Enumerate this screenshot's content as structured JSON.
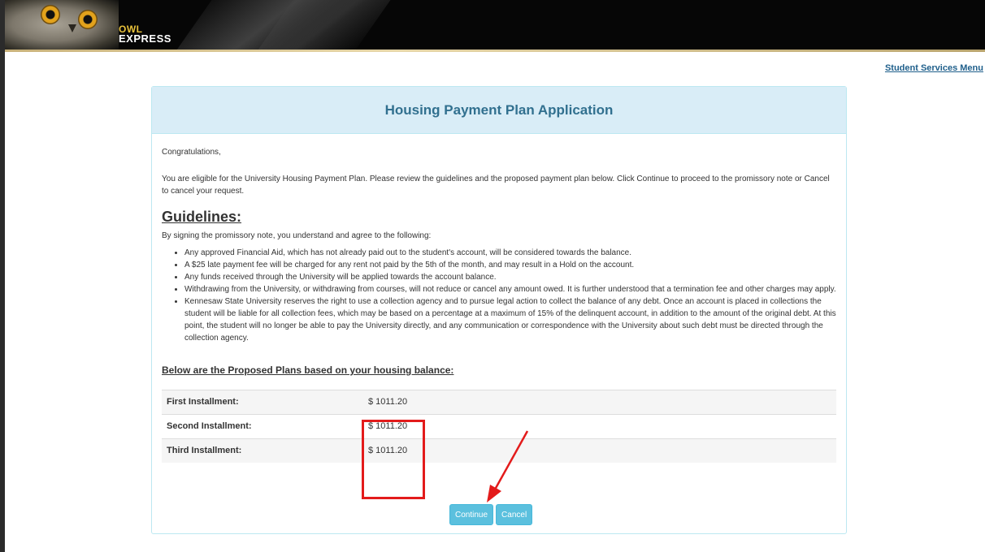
{
  "header": {
    "logo_line1": "OWL",
    "logo_line2": "EXPRESS"
  },
  "nav": {
    "student_services_menu": "Student Services Menu"
  },
  "panel": {
    "title": "Housing Payment Plan Application",
    "greeting": "Congratulations,",
    "eligibility_text": "You are eligible for the University Housing Payment Plan. Please review the guidelines and the proposed payment plan below. Click Continue to proceed to the promissory note or Cancel to cancel your request.",
    "guidelines_heading": "Guidelines:",
    "guidelines_intro": "By signing the promissory note, you understand and agree to the following:",
    "guidelines": [
      "Any approved Financial Aid, which has not already paid out to the student's account, will be considered towards the balance.",
      "A $25 late payment fee will be charged for any rent not paid by the 5th of the month, and may result in a Hold on the account.",
      "Any funds received through the University will be applied towards the account balance.",
      "Withdrawing from the University, or withdrawing from courses, will not reduce or cancel any amount owed. It is further understood that a termination fee and other charges may apply.",
      "Kennesaw State University reserves the right to use a collection agency and to pursue legal action to collect the balance of any debt. Once an account is placed in collections the student will be liable for all collection fees, which may be based on a percentage at a maximum of 15% of the delinquent account, in addition to the amount of the original debt. At this point, the student will no longer be able to pay the University directly, and any communication or correspondence with the University about such debt must be directed through the collection agency."
    ],
    "plans_heading": "Below are the Proposed Plans based on your housing balance:",
    "plans": [
      {
        "label": "First Installment:",
        "amount": "$ 1011.20"
      },
      {
        "label": "Second Installment:",
        "amount": "$ 1011.20"
      },
      {
        "label": "Third Installment:",
        "amount": "$ 1011.20"
      }
    ],
    "continue_label": "Continue",
    "cancel_label": "Cancel"
  },
  "colors": {
    "panel_header_bg": "#d9edf7",
    "panel_title": "#31708f",
    "button_bg": "#5bc0de",
    "annotation_red": "#e31b1b",
    "link": "#1f5f8b"
  }
}
